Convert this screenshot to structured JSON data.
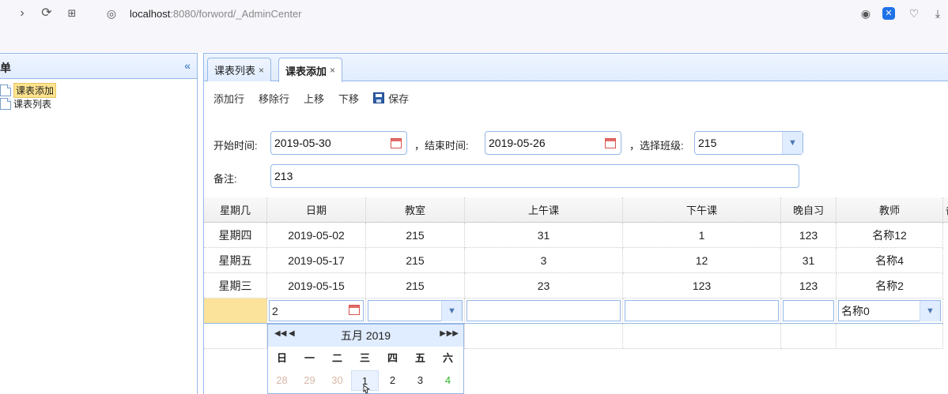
{
  "browser": {
    "url_host": "localhost",
    "url_path": ":8080/forword/_AdminCenter"
  },
  "left": {
    "title": "单",
    "items": [
      {
        "label": "课表添加",
        "selected": true
      },
      {
        "label": "课表列表",
        "selected": false
      }
    ]
  },
  "tabs": [
    {
      "label": "课表列表",
      "close": "×"
    },
    {
      "label": "课表添加",
      "close": "×"
    }
  ],
  "toolbar": {
    "add_row": "添加行",
    "remove_row": "移除行",
    "move_up": "上移",
    "move_down": "下移",
    "save": "保存"
  },
  "form": {
    "start_label": "开始时间:",
    "start_value": "2019-05-30",
    "end_label": "，结束时间:",
    "end_value": "2019-05-26",
    "class_label": "，选择班级:",
    "class_value": "215",
    "note_label": "备注:",
    "note_value": "213"
  },
  "grid": {
    "columns": [
      "星期几",
      "日期",
      "教室",
      "上午课",
      "下午课",
      "晚自习",
      "教师",
      "备"
    ],
    "rows": [
      [
        "星期四",
        "2019-05-02",
        "215",
        "31",
        "1",
        "123",
        "名称12"
      ],
      [
        "星期五",
        "2019-05-17",
        "215",
        "3",
        "12",
        "31",
        "名称4"
      ],
      [
        "星期三",
        "2019-05-15",
        "215",
        "23",
        "123",
        "123",
        "名称2"
      ]
    ],
    "edit_row": {
      "date": "2",
      "teacher": "名称0"
    }
  },
  "calendar": {
    "title": "五月 2019",
    "weekdays": [
      "日",
      "一",
      "二",
      "三",
      "四",
      "五",
      "六"
    ],
    "days": [
      "28",
      "29",
      "30",
      "1",
      "2",
      "3",
      "4"
    ]
  },
  "colors": {
    "border": "#95b8e7",
    "header_bg": "#e0ecff",
    "selected_row": "#fbe39b"
  }
}
